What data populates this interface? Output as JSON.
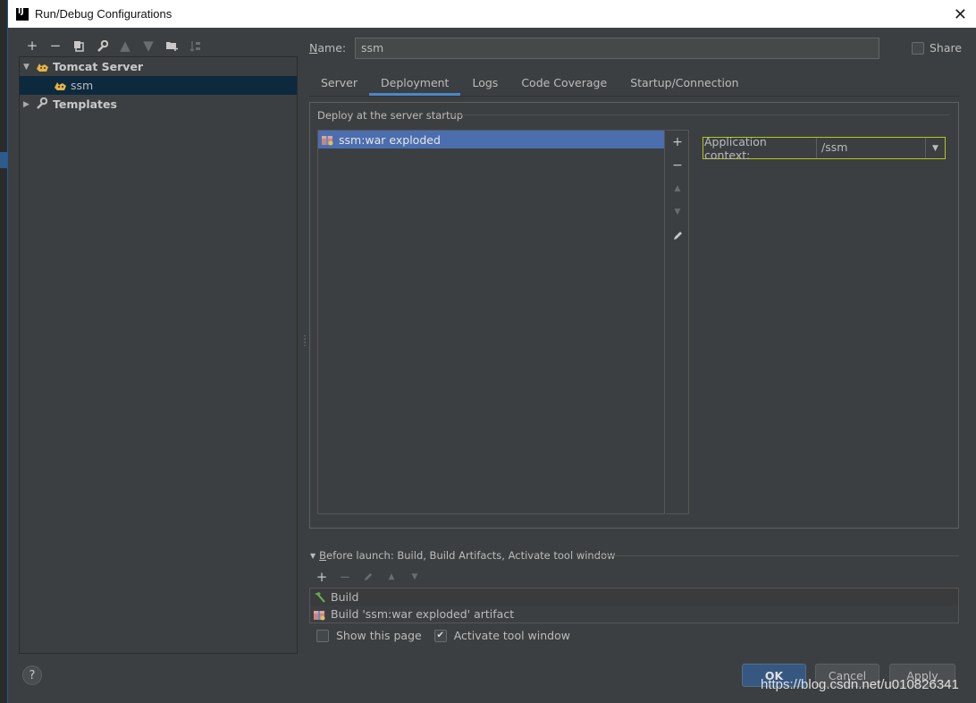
{
  "window": {
    "title": "Run/Debug Configurations",
    "app_icon_text": "IJ"
  },
  "left_toolbar": {
    "icons": [
      "add-icon",
      "remove-icon",
      "copy-icon",
      "wrench-icon",
      "move-up-icon",
      "move-down-icon",
      "new-folder-icon",
      "sort-icon"
    ]
  },
  "tree": {
    "group_label": "Tomcat Server",
    "child_label": "ssm",
    "templates_label": "Templates"
  },
  "name_field": {
    "label_prefix": "N",
    "label_rest": "ame:",
    "value": "ssm"
  },
  "share": {
    "label": "Share",
    "checked": false
  },
  "tabs": [
    {
      "label": "Server"
    },
    {
      "label": "Deployment"
    },
    {
      "label": "Logs"
    },
    {
      "label": "Code Coverage"
    },
    {
      "label": "Startup/Connection"
    }
  ],
  "active_tab": "Deployment",
  "deployment": {
    "title": "Deploy at the server startup",
    "artifacts": [
      "ssm:war exploded"
    ],
    "context_label": "Application context:",
    "context_value": "/ssm"
  },
  "before_launch": {
    "header_prefix": "B",
    "header_rest": "efore launch: Build, Build Artifacts, Activate tool window",
    "items": [
      "Build",
      "Build 'ssm:war exploded' artifact"
    ],
    "show_page_label": "Show this page",
    "show_page_checked": false,
    "activate_label": "Activate tool window",
    "activate_checked": true
  },
  "buttons": {
    "ok": "OK",
    "cancel": "Cancel",
    "apply": "Apply",
    "help": "?"
  },
  "watermark": "https://blog.csdn.net/u010826341",
  "colors": {
    "background": "#3c3f41",
    "selection": "#4b6eaf",
    "tab_accent": "#4a88c7",
    "ok_button": "#365880",
    "context_highlight": "#b4c71a"
  }
}
